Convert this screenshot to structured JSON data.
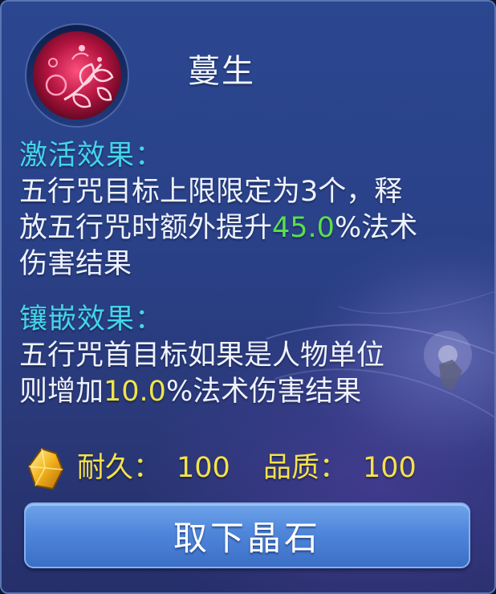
{
  "gem": {
    "name": "蔓生",
    "icon": "gem-vine-icon",
    "accent_color": "#e4386c"
  },
  "activation": {
    "heading": "激活效果：",
    "line1": "五行咒目标上限限定为3个，释",
    "line2_pre": "放五行咒时额外提升",
    "line2_value": "45.0",
    "line2_post": "%法术",
    "line3": "伤害结果",
    "value_color": "#58e04e"
  },
  "inlay": {
    "heading": "镶嵌效果：",
    "line1": "五行咒首目标如果是人物单位",
    "line2_pre": "则增加",
    "line2_value": "10.0",
    "line2_post": "%法术伤害结果",
    "value_color": "#f0e44a"
  },
  "stats": {
    "icon": "crystal-icon",
    "durability_label": "耐久：",
    "durability_value": "100",
    "quality_label": "品质：",
    "quality_value": "100",
    "color": "#f4e24a"
  },
  "action": {
    "remove_label": "取下晶石"
  }
}
